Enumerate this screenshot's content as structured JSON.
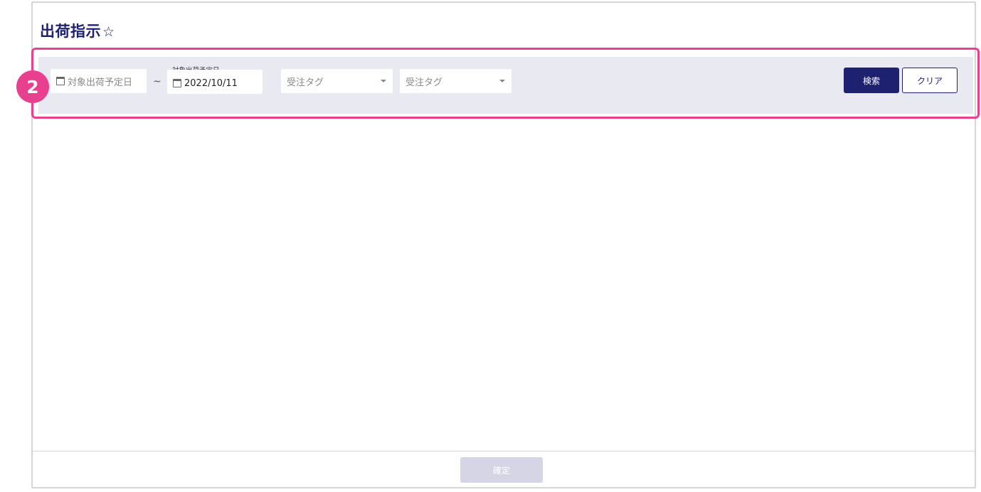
{
  "header": {
    "title": "出荷指示",
    "favorite_icon": "☆"
  },
  "annotation": {
    "step_number": "2",
    "highlight_color": "#e8408f"
  },
  "filters": {
    "date_from": {
      "placeholder": "対象出荷予定日",
      "value": ""
    },
    "separator": "~",
    "date_to": {
      "label": "対象出荷予定日",
      "value": "2022/10/11"
    },
    "tag_select_1": {
      "placeholder": "受注タグ"
    },
    "tag_select_2": {
      "placeholder": "受注タグ"
    }
  },
  "actions": {
    "search_label": "検索",
    "clear_label": "クリア",
    "confirm_label": "確定"
  },
  "colors": {
    "primary": "#1e2170",
    "filter_bg": "#e9e9f2",
    "disabled": "#d5d5e6"
  }
}
